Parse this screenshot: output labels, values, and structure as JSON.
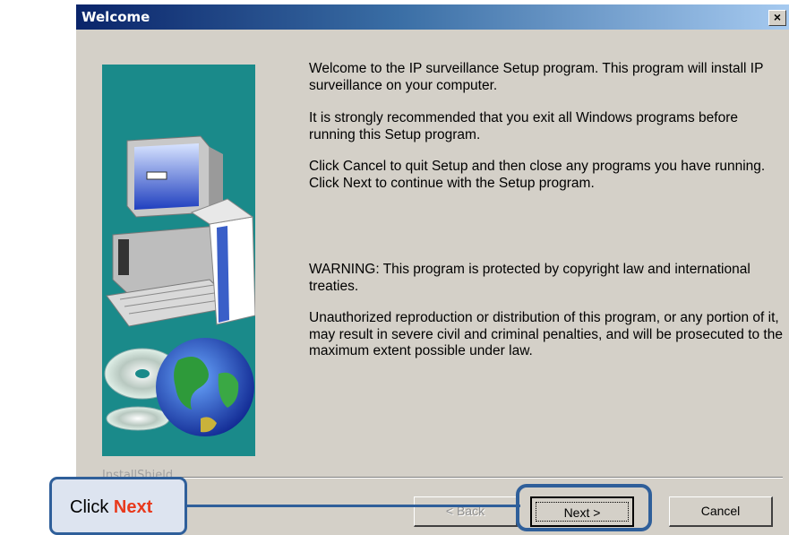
{
  "window": {
    "title": "Welcome",
    "close_label": "×"
  },
  "body": {
    "paragraphs": [
      "Welcome to the IP surveillance Setup program.  This program will install IP surveillance on your computer.",
      "It is strongly recommended that you exit all Windows programs before running this Setup program.",
      "Click Cancel to quit Setup and then close any programs you have running.  Click Next to continue with the Setup program.",
      "WARNING: This program is protected by copyright law and international treaties.",
      "Unauthorized reproduction or distribution of this program, or any portion of it, may result in severe civil and criminal penalties, and will be prosecuted to the maximum extent possible under law."
    ]
  },
  "footer": {
    "group_label": "InstallShield",
    "back_label": "< Back",
    "next_label": "Next >",
    "cancel_label": "Cancel"
  },
  "annotation": {
    "prefix": "Click ",
    "highlight": "Next"
  },
  "colors": {
    "title_gradient_start": "#0a246a",
    "dialog_face": "#d4d0c8",
    "art_background": "#1a8a8a",
    "callout_border": "#2f5f9a",
    "callout_highlight": "#e8391c"
  }
}
